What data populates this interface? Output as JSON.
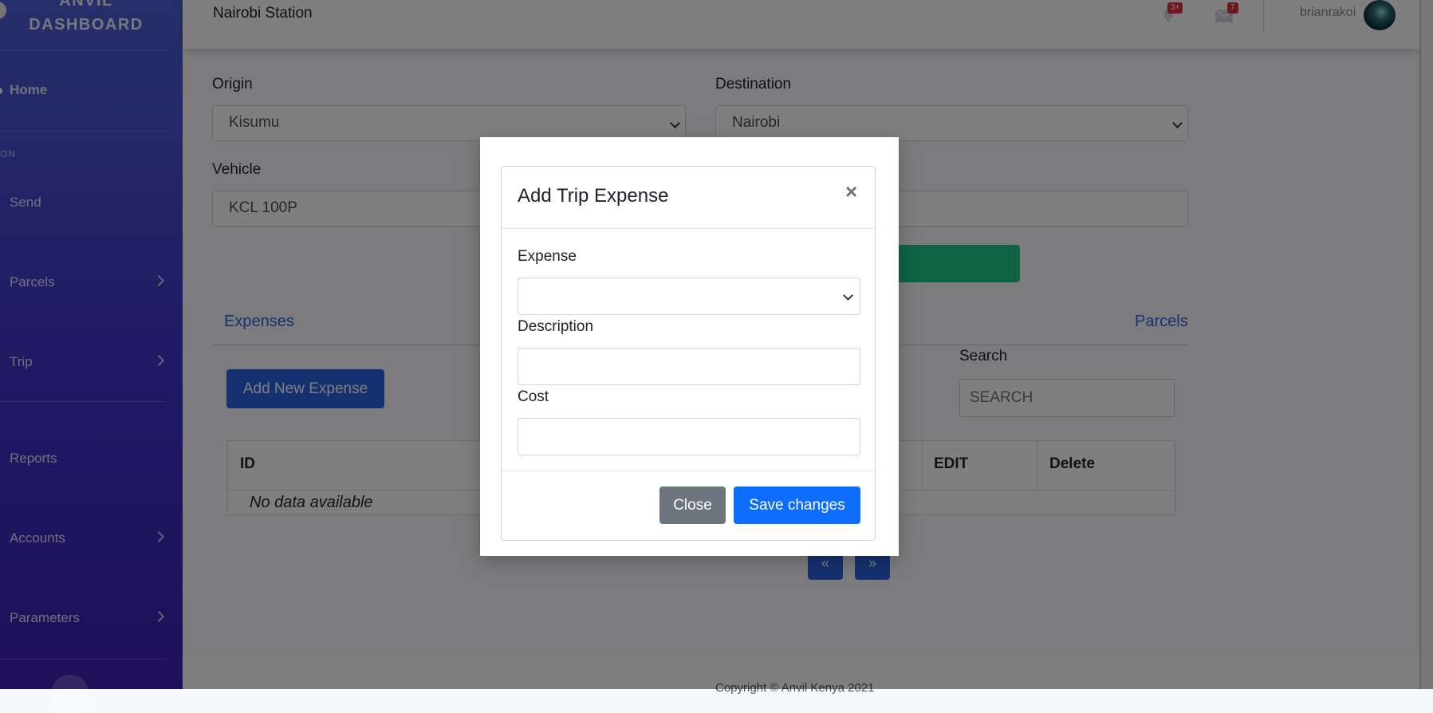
{
  "sidebar": {
    "brand": "ANVIL DASHBOARD",
    "home": "Home",
    "heading": "ON",
    "items": [
      {
        "label": "Send"
      },
      {
        "label": "Parcels"
      },
      {
        "label": "Trip"
      },
      {
        "label": "Reports"
      },
      {
        "label": "Accounts"
      },
      {
        "label": "Parameters"
      }
    ]
  },
  "topbar": {
    "station": "Nairobi Station",
    "alerts_badge": "3+",
    "messages_badge": "7",
    "username": "brianrakoi"
  },
  "form": {
    "origin_label": "Origin",
    "origin_value": "Kisumu",
    "destination_label": "Destination",
    "destination_value": "Nairobi",
    "vehicle_label": "Vehicle",
    "vehicle_value": "KCL 100P"
  },
  "tabs": {
    "expenses": "Expenses",
    "parcels": "Parcels"
  },
  "expenses": {
    "add_button": "Add New Expense",
    "search_label": "Search",
    "search_placeholder": "SEARCH",
    "columns": {
      "id": "ID",
      "edit": "EDIT",
      "delete": "Delete"
    },
    "empty": "No data available"
  },
  "pagination": {
    "prev": "«",
    "next": "»"
  },
  "footer": {
    "text": "Copyright © Anvil Kenya 2021"
  },
  "modal": {
    "title": "Add Trip Expense",
    "close_symbol": "×",
    "expense_label": "Expense",
    "expense_value": "",
    "description_label": "Description",
    "description_value": "",
    "cost_label": "Cost",
    "cost_value": "",
    "close_button": "Close",
    "save_button": "Save changes"
  },
  "colors": {
    "sidebar_top": "#4e5fd6",
    "sidebar_bottom": "#3d1fb5",
    "primary": "#2c63e0",
    "success": "#1cc88a",
    "secondary": "#6c757d",
    "badge": "#e02d3c"
  }
}
